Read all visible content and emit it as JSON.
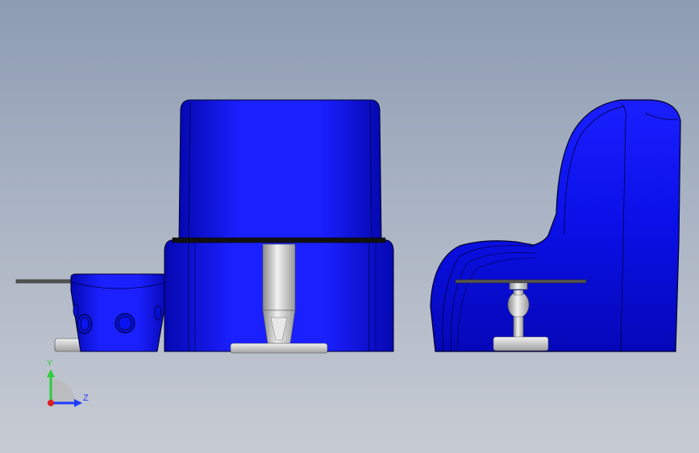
{
  "viewport": {
    "background_top": "#8d9cb3",
    "background_bottom": "#c7cbd3",
    "model_color": "#0a10e6",
    "edge_color": "#000033",
    "metal_color": "#c8c8c8"
  },
  "triad": {
    "y_label": "Y",
    "z_label": "Z",
    "y_color": "#2ecc40",
    "z_color": "#1e3cff",
    "x_color": "#e02020"
  },
  "parts": [
    {
      "name": "pouf",
      "icon": "pouf-shape"
    },
    {
      "name": "sofa-front",
      "icon": "sofa-front-shape"
    },
    {
      "name": "sofa-side",
      "icon": "sofa-side-shape"
    }
  ]
}
